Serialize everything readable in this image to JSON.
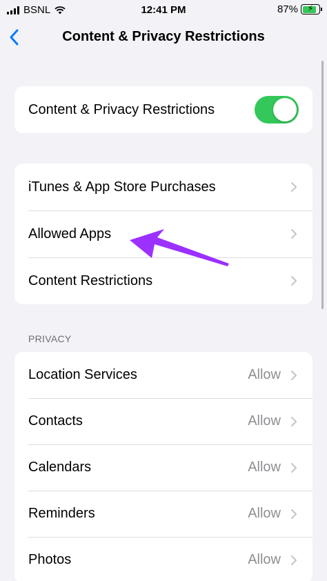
{
  "status_bar": {
    "carrier": "BSNL",
    "time": "12:41 PM",
    "battery": "87%",
    "battery_level": 0.87
  },
  "nav": {
    "title": "Content & Privacy Restrictions"
  },
  "master_toggle": {
    "label": "Content & Privacy Restrictions",
    "on": true,
    "on_color": "#34c759"
  },
  "content_group": {
    "items": [
      {
        "label": "iTunes & App Store Purchases"
      },
      {
        "label": "Allowed Apps"
      },
      {
        "label": "Content Restrictions"
      }
    ]
  },
  "privacy": {
    "header": "PRIVACY",
    "items": [
      {
        "label": "Location Services",
        "value": "Allow"
      },
      {
        "label": "Contacts",
        "value": "Allow"
      },
      {
        "label": "Calendars",
        "value": "Allow"
      },
      {
        "label": "Reminders",
        "value": "Allow"
      },
      {
        "label": "Photos",
        "value": "Allow"
      }
    ]
  },
  "colors": {
    "accent": "#007aff",
    "annotation_arrow": "#9b30ff"
  }
}
